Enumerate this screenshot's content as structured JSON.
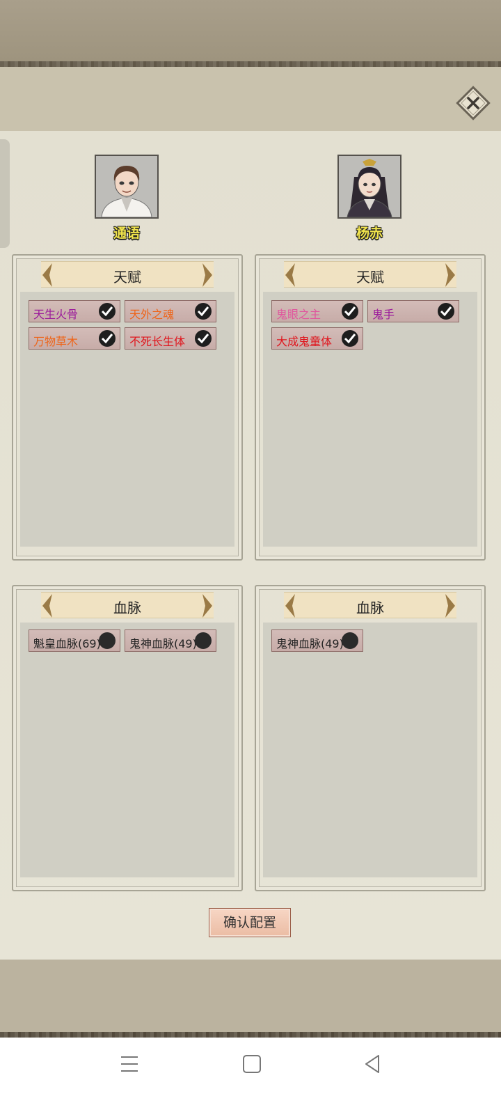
{
  "characters": [
    {
      "name": "通语"
    },
    {
      "name": "杨赤"
    }
  ],
  "talent": {
    "title": "天赋",
    "left": [
      {
        "label": "天生火骨",
        "checked": true,
        "color": "#9b1a9b"
      },
      {
        "label": "天外之魂",
        "checked": true,
        "color": "#ee6418"
      },
      {
        "label": "万物草木",
        "checked": true,
        "color": "#ee6418"
      },
      {
        "label": "不死长生体",
        "checked": true,
        "color": "#e0141c"
      }
    ],
    "right": [
      {
        "label": "鬼眼之主",
        "checked": true,
        "color": "#e0569d"
      },
      {
        "label": "鬼手",
        "checked": true,
        "color": "#9b1a9b"
      },
      {
        "label": "大成鬼童体",
        "checked": true,
        "color": "#e0141c"
      }
    ]
  },
  "bloodline": {
    "title": "血脉",
    "left": [
      {
        "label": "魁皇血脉(69)"
      },
      {
        "label": "鬼神血脉(49)"
      }
    ],
    "right": [
      {
        "label": "鬼神血脉(49)"
      }
    ]
  },
  "confirm_label": "确认配置",
  "icons": {
    "close": "close-icon",
    "arrow_left": "chevron-left-icon",
    "arrow_right": "chevron-right-icon",
    "checked": "checkmark-icon",
    "unchecked": "dot-icon",
    "nav_menu": "menu-icon",
    "nav_home": "home-icon",
    "nav_back": "back-icon"
  }
}
